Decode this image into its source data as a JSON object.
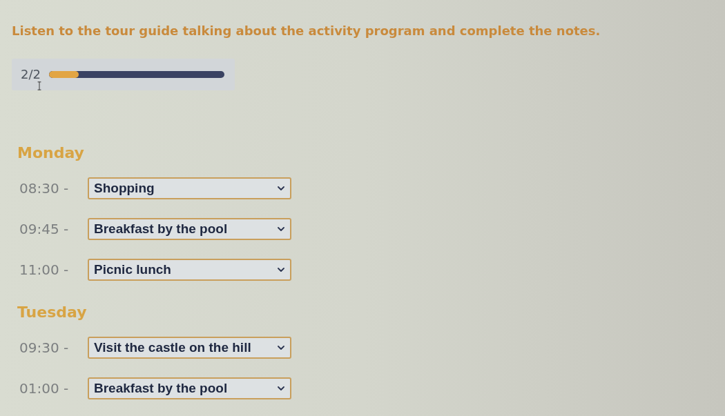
{
  "instruction": "Listen to the tour guide talking about the activity program and complete the notes.",
  "progress": {
    "counter": "2/2",
    "level": 0.17
  },
  "days": [
    {
      "day": "Monday",
      "items": [
        {
          "time": "08:30 -",
          "answer": "Shopping"
        },
        {
          "time": "09:45 -",
          "answer": "Breakfast by the pool"
        },
        {
          "time": "11:00 -",
          "answer": "Picnic lunch"
        }
      ]
    },
    {
      "day": "Tuesday",
      "items": [
        {
          "time": "09:30 -",
          "answer": "Visit the castle on the hill"
        },
        {
          "time": "01:00 -",
          "answer": "Breakfast by the pool"
        }
      ]
    }
  ]
}
